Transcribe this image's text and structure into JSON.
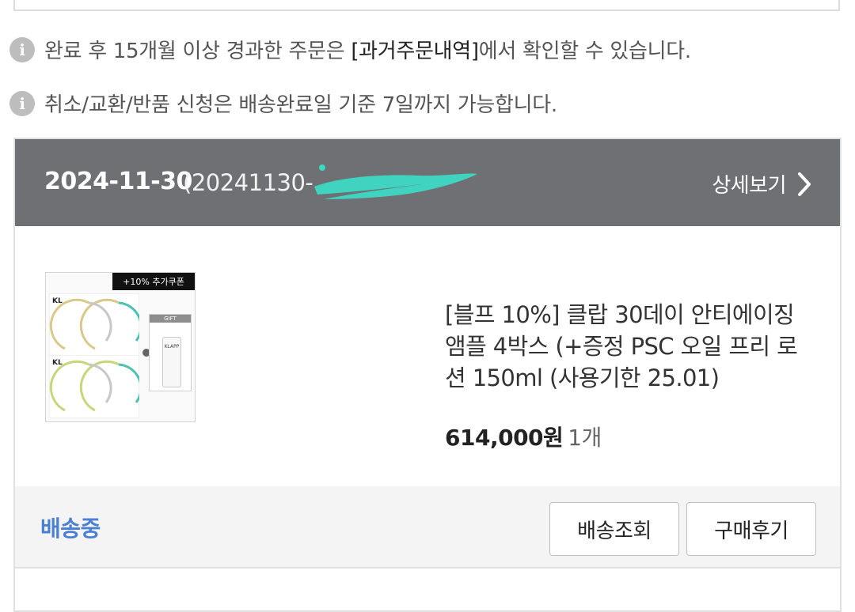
{
  "notices": [
    {
      "icon": "info-icon",
      "text_before": "완료 후 15개월 이상 경과한 주문은 ",
      "link": "[과거주문내역]",
      "text_after": "에서 확인할 수 있습니다."
    },
    {
      "icon": "info-icon",
      "text": "취소/교환/반품 신청은 배송완료일 기준 7일까지 가능합니다."
    }
  ],
  "order": {
    "date": "2024-11-30",
    "number_visible": "(20241130-",
    "detail_label": "상세보기",
    "product": {
      "thumbnail_coupon": "+10% 추가쿠폰",
      "thumbnail_gift": "GIFT",
      "thumbnail_bottle_brand": "KLAPP",
      "title": "[블프 10%] 클랍 30데이 안티에이징 앰플 4박스 (+증정 PSC 오일 프리 로션 150ml (사용기한 25.01)",
      "price": "614,000원",
      "quantity": "1개"
    },
    "status": "배송중",
    "buttons": {
      "track": "배송조회",
      "review": "구매후기"
    }
  },
  "colors": {
    "header_bg": "#6e7074",
    "status_blue": "#4a7fd6",
    "action_bg": "#f4f4f4",
    "redaction": "#3dd9c4"
  }
}
